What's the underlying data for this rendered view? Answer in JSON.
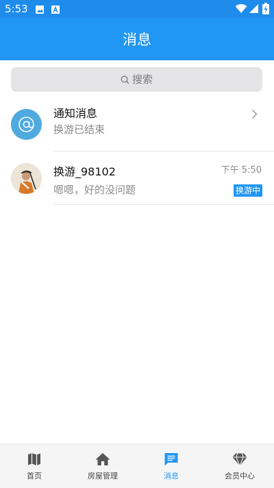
{
  "status_bar": {
    "time": "5:53"
  },
  "header": {
    "title": "消息"
  },
  "search": {
    "placeholder": "搜索"
  },
  "messages": [
    {
      "title": "通知消息",
      "preview": "换游已结束",
      "avatar_icon": "at-sign-icon",
      "has_chevron": true
    },
    {
      "title": "换游_98102",
      "preview": "嗯嗯，好的没问题",
      "time": "下午 5:50",
      "badge": "换游中",
      "avatar_icon": "user-avatar"
    }
  ],
  "tabs": [
    {
      "label": "首页",
      "icon": "map-icon",
      "active": false
    },
    {
      "label": "房屋管理",
      "icon": "home-icon",
      "active": false
    },
    {
      "label": "消息",
      "icon": "chat-icon",
      "active": true
    },
    {
      "label": "会员中心",
      "icon": "diamond-icon",
      "active": false
    }
  ],
  "colors": {
    "primary": "#2196f3",
    "status_bar": "#1f8cec",
    "notice_avatar": "#4eaadf"
  }
}
